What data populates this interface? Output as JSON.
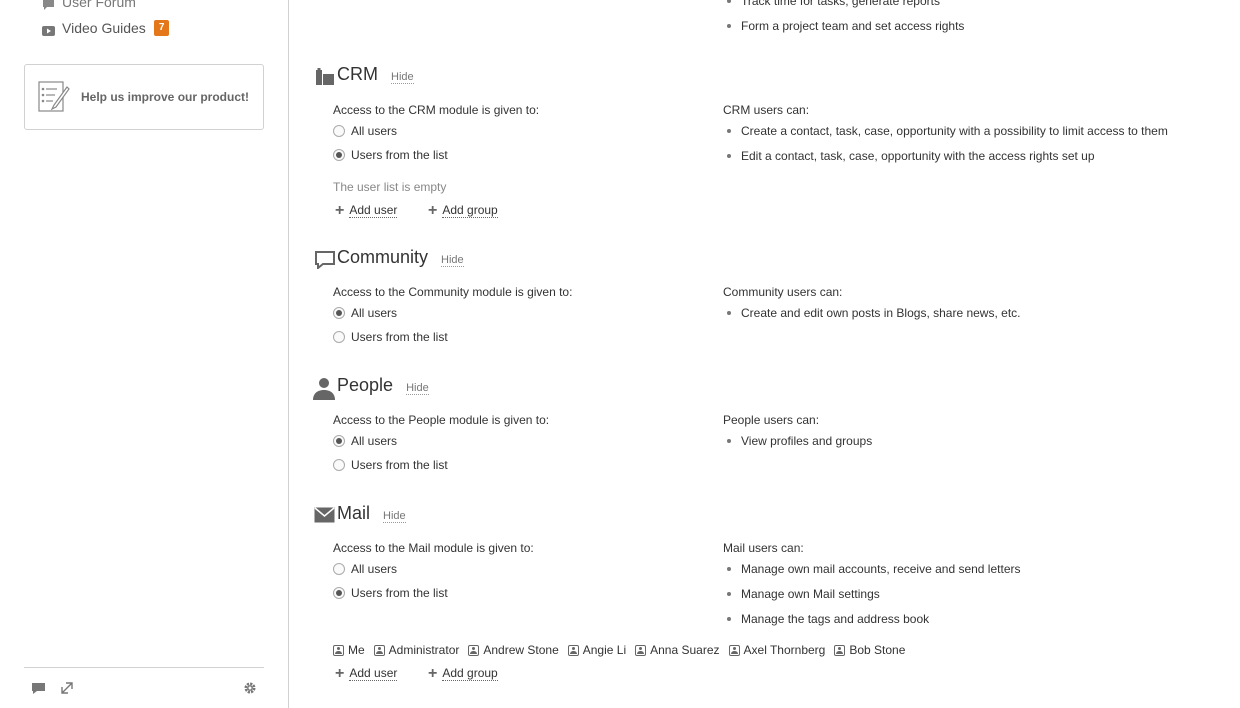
{
  "sidebar": {
    "forum_label": "User Forum",
    "video_label": "Video Guides",
    "video_badge": "7",
    "improve_label": "Help us improve our product!"
  },
  "top_bullets": [
    "Track time for tasks, generate reports",
    "Form a project team and set access rights"
  ],
  "hide_label": "Hide",
  "radio_all": "All users",
  "radio_list": "Users from the list",
  "add_user": "Add user",
  "add_group": "Add group",
  "crm": {
    "title": "CRM",
    "access": "Access to the CRM module is given to:",
    "can": "CRM users can:",
    "bullets": [
      "Create a contact, task, case, opportunity with a possibility to limit access to them",
      "Edit a contact, task, case, opportunity with the access rights set up"
    ],
    "empty": "The user list is empty",
    "selected": "list"
  },
  "community": {
    "title": "Community",
    "access": "Access to the Community module is given to:",
    "can": "Community users can:",
    "bullets": [
      "Create and edit own posts in Blogs, share news, etc."
    ],
    "selected": "all"
  },
  "people": {
    "title": "People",
    "access": "Access to the People module is given to:",
    "can": "People users can:",
    "bullets": [
      "View profiles and groups"
    ],
    "selected": "all"
  },
  "mail": {
    "title": "Mail",
    "access": "Access to the Mail module is given to:",
    "can": "Mail users can:",
    "bullets": [
      "Manage own mail accounts, receive and send letters",
      "Manage own Mail settings",
      "Manage the tags and address book"
    ],
    "selected": "list",
    "users": [
      "Me",
      "Administrator",
      "Andrew Stone",
      "Angie Li",
      "Anna Suarez",
      "Axel Thornberg",
      "Bob Stone"
    ]
  },
  "colors": {
    "badge": "#e3771a",
    "border": "#d1d1d1"
  }
}
